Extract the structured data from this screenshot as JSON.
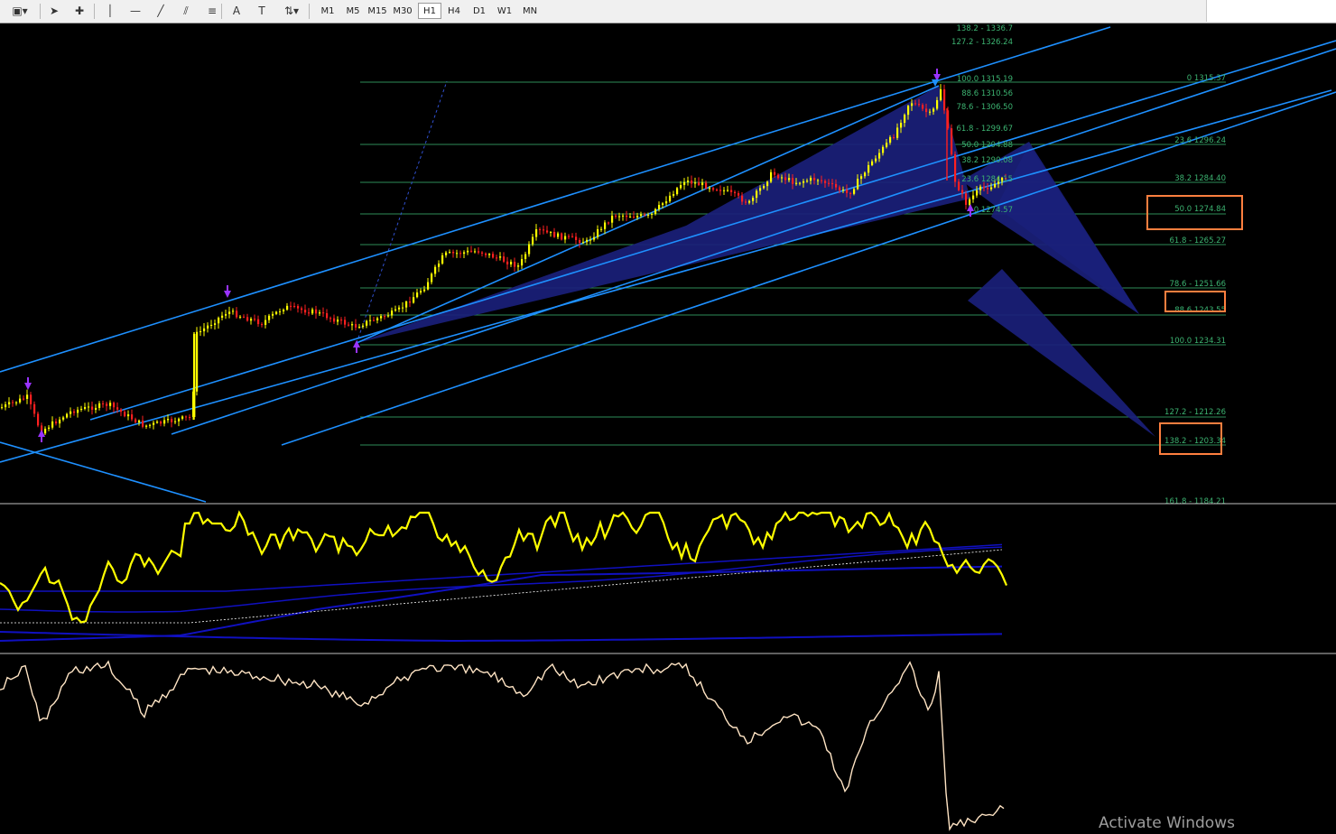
{
  "toolbar": {
    "tools": [
      {
        "name": "chart-type-icon",
        "glyph": "▣▾"
      },
      {
        "name": "cursor-icon",
        "glyph": "➤"
      },
      {
        "name": "crosshair-icon",
        "glyph": "✚"
      },
      {
        "name": "vertical-line-icon",
        "glyph": "│"
      },
      {
        "name": "horizontal-line-icon",
        "glyph": "—"
      },
      {
        "name": "trendline-icon",
        "glyph": "╱"
      },
      {
        "name": "channel-icon",
        "glyph": "⫽"
      },
      {
        "name": "fibonacci-icon",
        "glyph": "≡"
      },
      {
        "name": "text-icon",
        "glyph": "A"
      },
      {
        "name": "text-label-icon",
        "glyph": "T"
      },
      {
        "name": "arrows-icon",
        "glyph": "⇅▾"
      }
    ],
    "timeframes": [
      "M1",
      "M5",
      "M15",
      "M30",
      "H1",
      "H4",
      "D1",
      "W1",
      "MN"
    ],
    "active_timeframe": "H1"
  },
  "fib_left": [
    {
      "label": "138.2 - 1336.7"
    },
    {
      "label": "127.2 - 1326.24"
    },
    {
      "label": "100.0 1315.19"
    },
    {
      "label": "88.6 1310.56"
    },
    {
      "label": "78.6 - 1306.50"
    },
    {
      "label": "61.8 - 1299.67"
    },
    {
      "label": "50.0 1294.88"
    },
    {
      "label": "38.2 1290.08"
    },
    {
      "label": "23.6 1284.15"
    },
    {
      "label": "0 1274.57"
    }
  ],
  "fib_right": [
    {
      "label": "0 1315.37"
    },
    {
      "label": "23.6 1296.24"
    },
    {
      "label": "38.2 1284.40"
    },
    {
      "label": "50.0 1274.84"
    },
    {
      "label": "61.8 - 1265.27"
    },
    {
      "label": "78.6 - 1251.66"
    },
    {
      "label": "88.6 1243.55"
    },
    {
      "label": "100.0 1234.31"
    },
    {
      "label": "127.2 - 1212.26"
    },
    {
      "label": "138.2 - 1203.34"
    },
    {
      "label": "161.8 - 1184.21"
    }
  ],
  "colors": {
    "bull_candle": "#ffff00",
    "bear_candle": "#ff2020",
    "channel": "#1e90ff",
    "fib_line": "#2e8b57",
    "fib_text": "#3cb371",
    "harmonic_fill": "#1a1f7a",
    "oscillator": "#ffff00",
    "bands": "#1010c0",
    "lower_line": "#ffe4c4",
    "highlight_box": "#ff7f3f"
  },
  "watermark": "Activate Windows"
}
